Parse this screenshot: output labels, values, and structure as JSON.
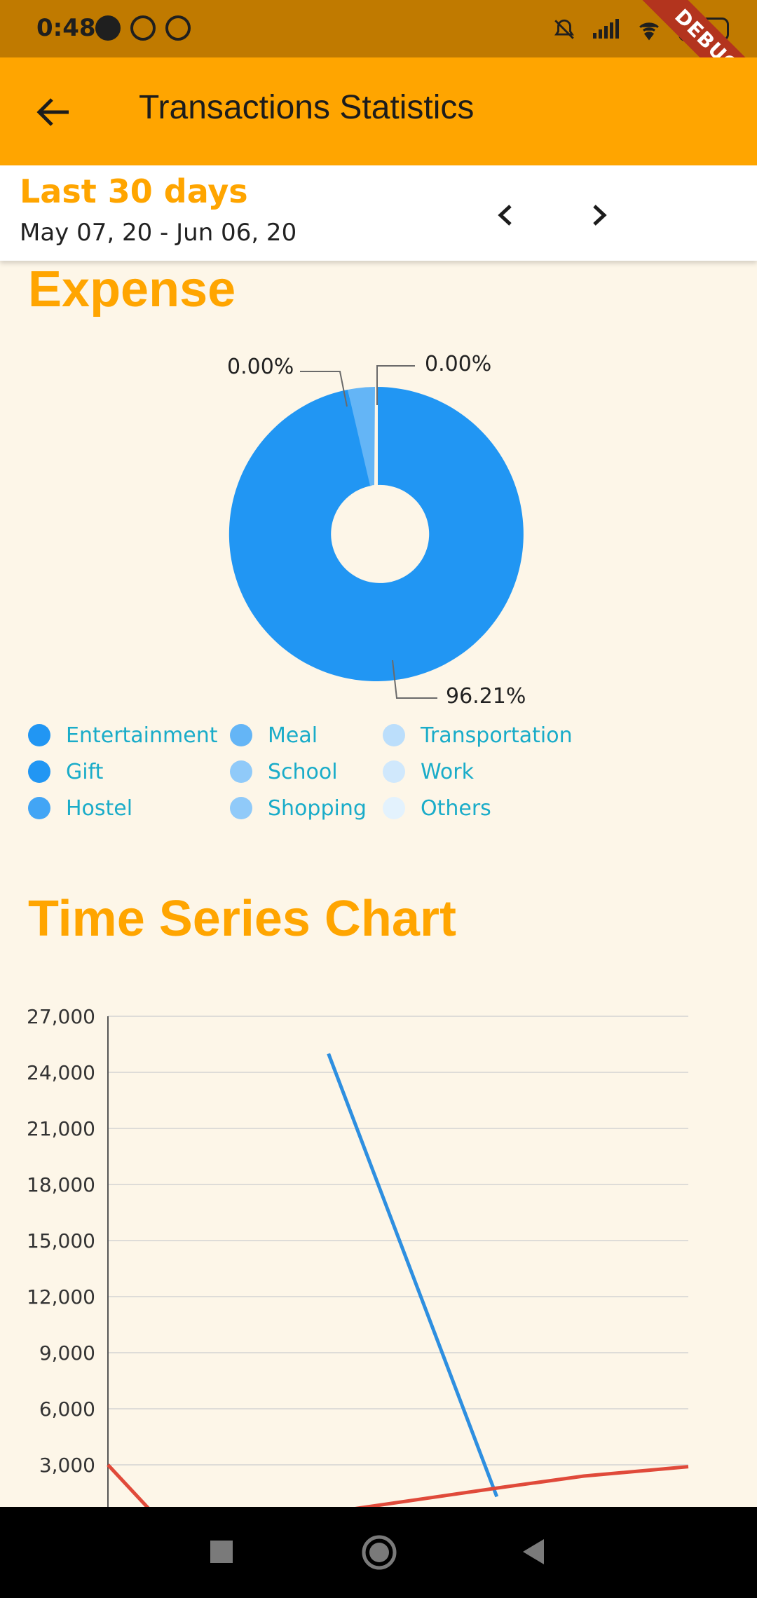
{
  "status": {
    "time": "0:48",
    "battery": "78"
  },
  "debug_banner": "DEBUG",
  "app_bar": {
    "title": "Transactions Statistics"
  },
  "range": {
    "title": "Last 30 days",
    "dates": "May 07, 20 - Jun 06, 20"
  },
  "expense": {
    "title": "Expense",
    "pie_labels": [
      "0.00%",
      "0.00%",
      "96.21%"
    ]
  },
  "legend": [
    {
      "label": "Entertainment",
      "color": "#2196F3"
    },
    {
      "label": "Gift",
      "color": "#2196F3"
    },
    {
      "label": "Hostel",
      "color": "#42A5F5"
    },
    {
      "label": "Meal",
      "color": "#64B5F6"
    },
    {
      "label": "School",
      "color": "#90CAF9"
    },
    {
      "label": "Shopping",
      "color": "#90CAF9"
    },
    {
      "label": "Transportation",
      "color": "#BBDEFB"
    },
    {
      "label": "Work",
      "color": "#D0E8FC"
    },
    {
      "label": "Others",
      "color": "#E3F2FD"
    }
  ],
  "time_series": {
    "title": "Time Series Chart"
  },
  "chart_data": {
    "type": "line",
    "yticks": [
      "27,000",
      "24,000",
      "21,000",
      "18,000",
      "15,000",
      "12,000",
      "9,000",
      "6,000",
      "3,000"
    ],
    "ylim": [
      0,
      27000
    ],
    "grid": true,
    "series": [
      {
        "color": "#2E8FE0",
        "points": [
          [
            0.38,
            25000
          ],
          [
            0.67,
            1300
          ]
        ]
      },
      {
        "color": "#E04A3A",
        "points": [
          [
            0.0,
            3000
          ],
          [
            0.09,
            0
          ],
          [
            0.28,
            0
          ],
          [
            0.68,
            1800
          ],
          [
            0.82,
            2400
          ],
          [
            1.0,
            2900
          ]
        ]
      }
    ]
  },
  "colors": {
    "accent": "#FFA500",
    "status_bar": "#C07A00",
    "background": "#FDF6E8",
    "pie_main": "#2196F3",
    "pie_small": "#64B5F6",
    "legend_text": "#1AACC9"
  }
}
